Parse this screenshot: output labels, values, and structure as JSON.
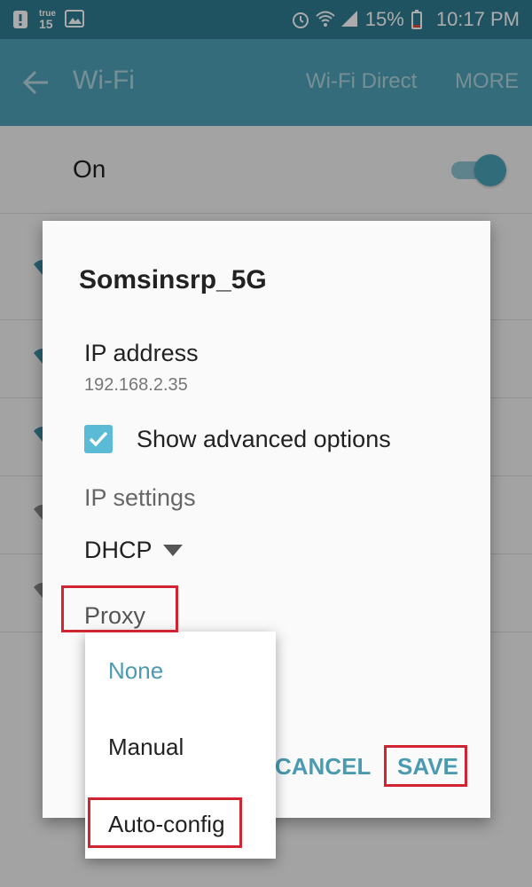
{
  "status_bar": {
    "carrier_badge": "true",
    "carrier_number": "15",
    "battery_percent": "15%",
    "time": "10:17 PM"
  },
  "app_bar": {
    "title": "Wi-Fi",
    "wifi_direct_label": "Wi-Fi Direct",
    "more_label": "MORE"
  },
  "wifi_switch": {
    "label": "On",
    "enabled": true
  },
  "dialog": {
    "ssid": "Somsinsrp_5G",
    "ip_address_label": "IP address",
    "ip_address_value": "192.168.2.35",
    "show_advanced_label": "Show advanced options",
    "show_advanced_checked": true,
    "ip_settings_label": "IP settings",
    "ip_settings_value": "DHCP",
    "proxy_label": "Proxy",
    "cancel_label": "CANCEL",
    "save_label": "SAVE"
  },
  "proxy_dropdown": {
    "options": [
      "None",
      "Manual",
      "Auto-config"
    ],
    "selected": "None"
  },
  "colors": {
    "accent": "#4a9ab2",
    "app_bar": "#4fa2b8",
    "status_bar": "#2f7c91",
    "checkbox": "#5bbbd6",
    "highlight_box": "#d02530"
  }
}
